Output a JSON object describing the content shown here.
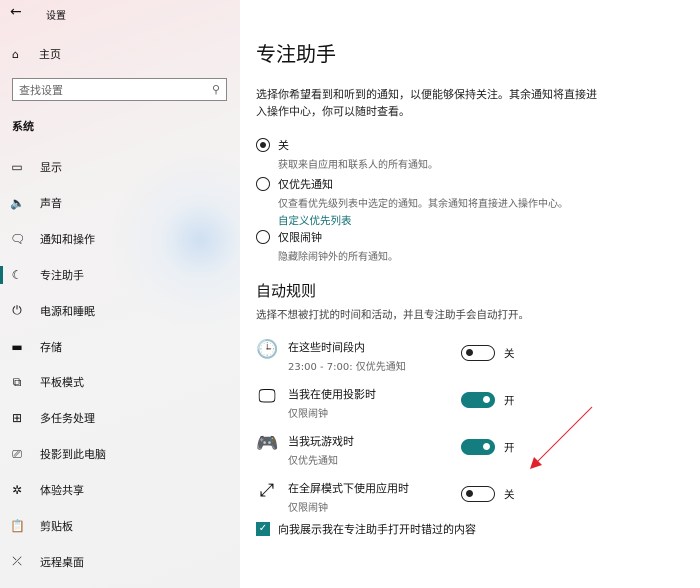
{
  "sidebar": {
    "back": "←",
    "title": "设置",
    "home": "主页",
    "search_placeholder": "查找设置",
    "section": "系统",
    "items": [
      {
        "label": "显示",
        "icon": "▭"
      },
      {
        "label": "声音",
        "icon": "🔈"
      },
      {
        "label": "通知和操作",
        "icon": "🗨"
      },
      {
        "label": "专注助手",
        "icon": "☾"
      },
      {
        "label": "电源和睡眠",
        "icon": "⏻"
      },
      {
        "label": "存储",
        "icon": "▬"
      },
      {
        "label": "平板模式",
        "icon": "⧉"
      },
      {
        "label": "多任务处理",
        "icon": "⊞"
      },
      {
        "label": "投影到此电脑",
        "icon": "⎚"
      },
      {
        "label": "体验共享",
        "icon": "✲"
      },
      {
        "label": "剪贴板",
        "icon": "📋"
      },
      {
        "label": "远程桌面",
        "icon": "⤫"
      }
    ]
  },
  "main": {
    "title": "专注助手",
    "intro": "选择你希望看到和听到的通知，以便能够保持关注。其余通知将直接进入操作中心，你可以随时查看。",
    "options": [
      {
        "label": "关",
        "desc": "获取来自应用和联系人的所有通知。",
        "selected": true
      },
      {
        "label": "仅优先通知",
        "desc": "仅查看优先级列表中选定的通知。其余通知将直接进入操作中心。",
        "link": "自定义优先列表",
        "selected": false
      },
      {
        "label": "仅限闹钟",
        "desc": "隐藏除闹钟外的所有通知。",
        "selected": false
      }
    ],
    "rules_title": "自动规则",
    "rules_desc": "选择不想被打扰的时间和活动，并且专注助手会自动打开。",
    "rules": [
      {
        "title": "在这些时间段内",
        "sub": "23:00 - 7:00: 仅优先通知",
        "on": false,
        "state": "关",
        "icon": "🕒"
      },
      {
        "title": "当我在使用投影时",
        "sub": "仅限闹钟",
        "on": true,
        "state": "开",
        "icon": "🖵"
      },
      {
        "title": "当我玩游戏时",
        "sub": "仅优先通知",
        "on": true,
        "state": "开",
        "icon": "🎮"
      },
      {
        "title": "在全屏模式下使用应用时",
        "sub": "仅限闹钟",
        "on": false,
        "state": "关",
        "icon": "⤢"
      }
    ],
    "checkbox": "向我展示我在专注助手打开时错过的内容",
    "checkbox_checked": true
  },
  "accent": "#137d80"
}
